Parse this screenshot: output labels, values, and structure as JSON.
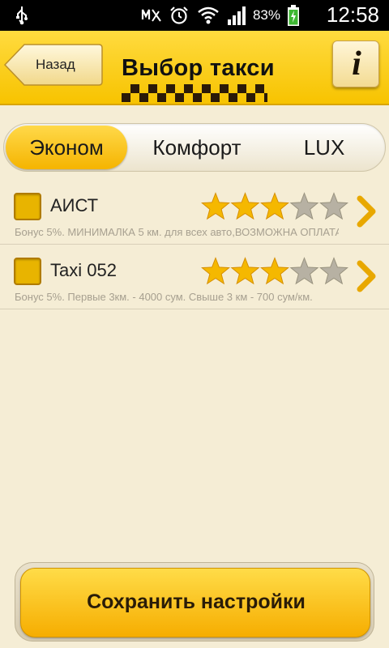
{
  "status_bar": {
    "battery_percent": "83%",
    "time": "12:58",
    "icons": [
      "usb-icon",
      "mute-icon",
      "alarm-icon",
      "wifi-icon",
      "signal-icon",
      "battery-charging-icon"
    ]
  },
  "header": {
    "back_label": "Назад",
    "title": "Выбор такси",
    "info_icon": "i",
    "accent_color": "#f7c300"
  },
  "tabs": [
    {
      "label": "Эконом",
      "active": true
    },
    {
      "label": "Комфорт",
      "active": false
    },
    {
      "label": "LUX",
      "active": false
    }
  ],
  "taxi_list": [
    {
      "name": "АИСТ",
      "checked": true,
      "rating": 3,
      "rating_max": 5,
      "description": "Бонус 5%. МИНИМАЛКА 5 км. для всех авто,ВОЗМОЖНА ОПЛАТА"
    },
    {
      "name": "Taxi 052",
      "checked": true,
      "rating": 3,
      "rating_max": 5,
      "description": "Бонус 5%. Первые 3км. - 4000 сум. Свыше 3 км - 700 сум/км."
    }
  ],
  "save_button_label": "Сохранить настройки"
}
